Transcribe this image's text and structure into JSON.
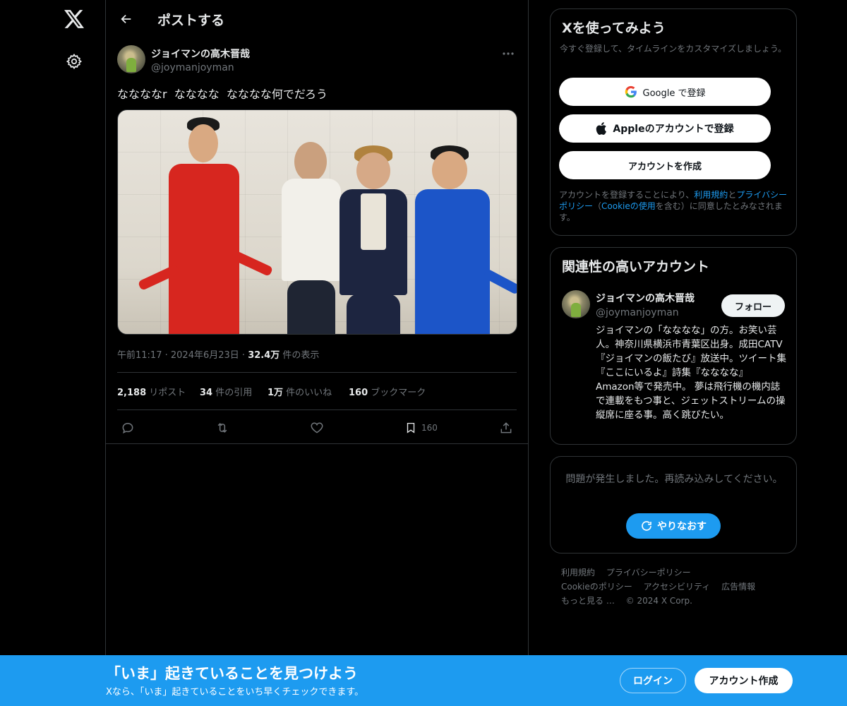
{
  "header": {
    "title": "ポストする"
  },
  "tweet": {
    "author_name": "ジョイマンの高木晋哉",
    "author_handle": "@joymanjoyman",
    "text": "ななななr  なななな  なななな何でだろう",
    "meta_time": "午前11:17",
    "meta_date": "2024年6月23日",
    "meta_views_count": "32.4万",
    "meta_views_label": " 件の表示",
    "stats": {
      "reposts_count": "2,188",
      "reposts_label": " リポスト",
      "quotes_count": "34",
      "quotes_label": " 件の引用",
      "likes_count": "1万",
      "likes_label": " 件のいいね",
      "bookmarks_count": "160",
      "bookmarks_label": " ブックマーク"
    },
    "actions": {
      "bookmark_count": "160"
    }
  },
  "signup_card": {
    "title": "Xを使ってみよう",
    "subtitle": "今すぐ登録して、タイムラインをカスタマイズしましょう。",
    "google_label": "Google で登録",
    "apple_label": "Appleのアカウントで登録",
    "create_label": "アカウントを作成",
    "legal_pre": "アカウントを登録することにより、",
    "legal_terms": "利用規約",
    "legal_and": "と",
    "legal_privacy": "プライバシーポリシー",
    "legal_mid": "（",
    "legal_cookie": "Cookieの使用",
    "legal_post": "を含む）に同意したとみなされます。"
  },
  "related": {
    "title": "関連性の高いアカウント",
    "name": "ジョイマンの高木晋哉",
    "handle": "@joymanjoyman",
    "follow_label": "フォロー",
    "bio": "ジョイマンの「なななな」の方。お笑い芸人。神奈川県横浜市青葉区出身。成田CATV『ジョイマンの飯たび』放送中。ツイート集『ここにいるよ』詩集『なななな』Amazon等で発売中。 夢は飛行機の機内誌で連載をもつ事と、ジェットストリームの操縦席に座る事。高く跳びたい。"
  },
  "error_card": {
    "message": "問題が発生しました。再読み込みしてください。",
    "retry_label": "やりなおす"
  },
  "footer": {
    "links": [
      "利用規約",
      "プライバシーポリシー",
      "Cookieのポリシー",
      "アクセシビリティ",
      "広告情報",
      "もっと見る …",
      "© 2024 X Corp."
    ]
  },
  "banner": {
    "title": "「いま」起きていることを見つけよう",
    "subtitle": "Xなら、「いま」起きていることをいち早くチェックできます。",
    "login_label": "ログイン",
    "signup_label": "アカウント作成"
  },
  "colors": {
    "accent": "#1d9bf0",
    "background": "#000000",
    "border": "#2f3336",
    "muted": "#71767b"
  }
}
